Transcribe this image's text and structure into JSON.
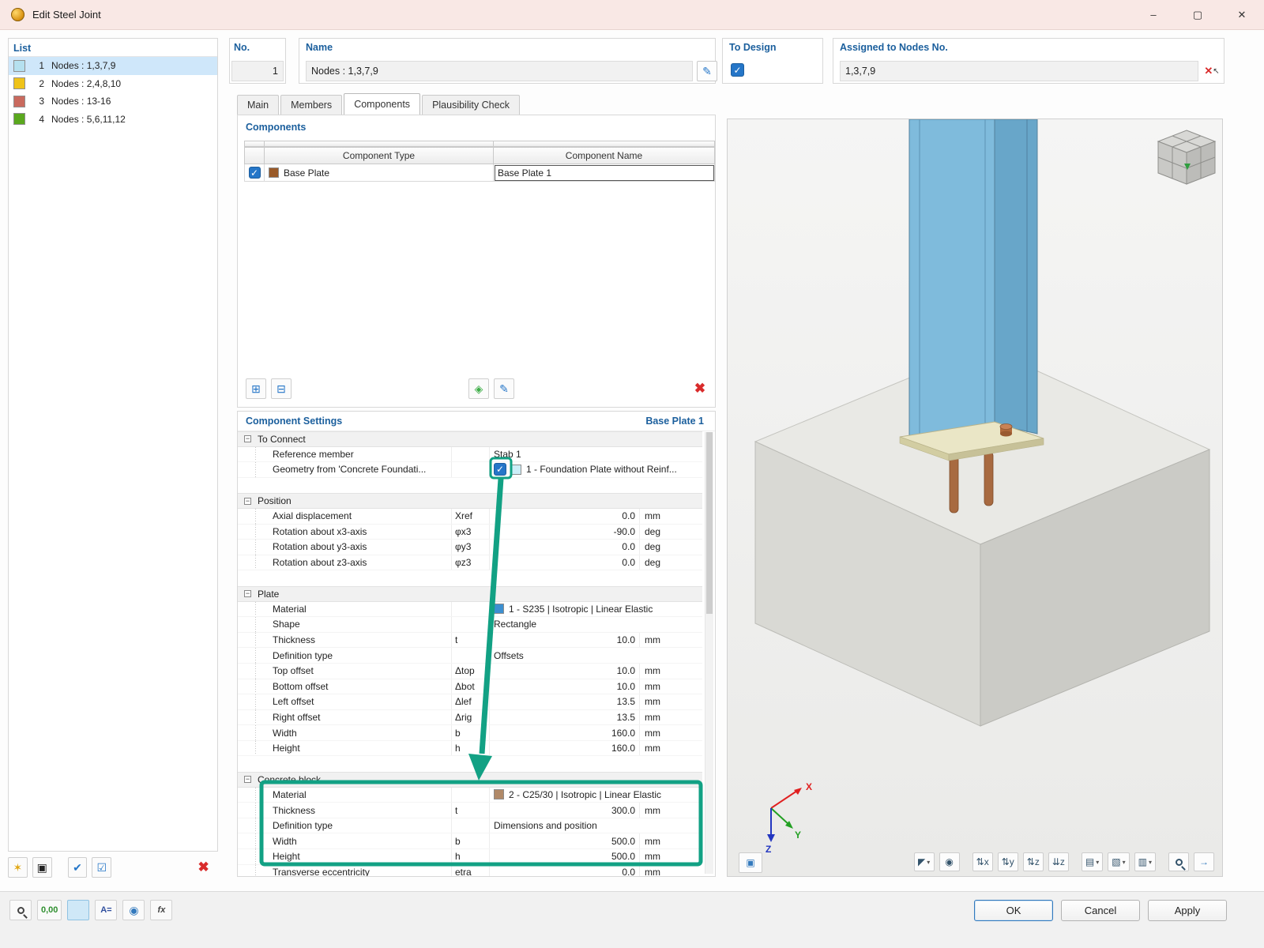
{
  "window": {
    "title": "Edit Steel Joint"
  },
  "icons": {
    "minimize": "–",
    "maximize": "▢",
    "close": "✕",
    "check": "✓",
    "collapse": "−",
    "caret": "▾",
    "edit_pencil": "✎",
    "pick_cross": "✕",
    "pick_cursor": "↖",
    "new_item": "✶",
    "copy_item": "▣",
    "check_all": "✔",
    "check_select": "☑",
    "delete_red": "✖",
    "insert_row": "⊞",
    "delete_row": "⊟",
    "import_lib": "◈",
    "save_template": "✎",
    "view_direction": "◤",
    "camera": "◉",
    "flip_x": "⇅x",
    "flip_y": "⇅y",
    "flip_z": "⇅z",
    "flip_z2": "⇊z",
    "layers": "▤",
    "display_style": "▧",
    "printer": "▥",
    "pan_arrow": "→",
    "navigator": "▣",
    "decimals": "0,00",
    "format_a": "A=",
    "display_eye": "◉",
    "formula": "fx"
  },
  "colors": {
    "accent_blue": "#1b5f9d",
    "annotation_green": "#12a184",
    "check_blue": "#2576c8",
    "delete_red": "#d92b2b"
  },
  "list": {
    "label": "List",
    "items": [
      {
        "no": "1",
        "name": "Nodes : 1,3,7,9",
        "color": "#b5e0ef",
        "selected": true
      },
      {
        "no": "2",
        "name": "Nodes : 2,4,8,10",
        "color": "#efc319",
        "selected": false
      },
      {
        "no": "3",
        "name": "Nodes : 13-16",
        "color": "#c96a5e",
        "selected": false
      },
      {
        "no": "4",
        "name": "Nodes : 5,6,11,12",
        "color": "#5aa81e",
        "selected": false
      }
    ]
  },
  "header": {
    "no_label": "No.",
    "no_value": "1",
    "name_label": "Name",
    "name_value": "Nodes : 1,3,7,9",
    "to_design_label": "To Design",
    "to_design_checked": true,
    "assigned_label": "Assigned to Nodes No.",
    "assigned_value": "1,3,7,9"
  },
  "tabs": {
    "main": "Main",
    "members": "Members",
    "components": "Components",
    "plausibility": "Plausibility Check"
  },
  "components": {
    "title": "Components",
    "col_type": "Component Type",
    "col_name": "Component Name",
    "row": {
      "checked": true,
      "type": "Base Plate",
      "name": "Base Plate 1",
      "type_color": "#9a5a28"
    }
  },
  "settings": {
    "title": "Component Settings",
    "target": "Base Plate 1",
    "groups": [
      {
        "label": "To Connect",
        "rows": [
          {
            "label": "Reference member",
            "sym": "",
            "value": "Stab 1",
            "unit": ""
          },
          {
            "label": "Geometry from 'Concrete Foundati...",
            "sym": "",
            "value": "1 - Foundation Plate without Reinf...",
            "unit": "",
            "checked": true,
            "swatch": "#cdeef8"
          }
        ]
      },
      {
        "label": "Position",
        "rows": [
          {
            "label": "Axial displacement",
            "sym": "Xref",
            "value": "0.0",
            "unit": "mm"
          },
          {
            "label": "Rotation about x3-axis",
            "sym": "φx3",
            "value": "-90.0",
            "unit": "deg"
          },
          {
            "label": "Rotation about y3-axis",
            "sym": "φy3",
            "value": "0.0",
            "unit": "deg"
          },
          {
            "label": "Rotation about z3-axis",
            "sym": "φz3",
            "value": "0.0",
            "unit": "deg"
          }
        ]
      },
      {
        "label": "Plate",
        "rows": [
          {
            "label": "Material",
            "sym": "",
            "value": "1 - S235 | Isotropic | Linear Elastic",
            "unit": "",
            "swatch": "#3c8fd0"
          },
          {
            "label": "Shape",
            "sym": "",
            "value": "Rectangle",
            "unit": ""
          },
          {
            "label": "Thickness",
            "sym": "t",
            "value": "10.0",
            "unit": "mm"
          },
          {
            "label": "Definition type",
            "sym": "",
            "value": "Offsets",
            "unit": ""
          },
          {
            "label": "Top offset",
            "sym": "Δtop",
            "value": "10.0",
            "unit": "mm"
          },
          {
            "label": "Bottom offset",
            "sym": "Δbot",
            "value": "10.0",
            "unit": "mm"
          },
          {
            "label": "Left offset",
            "sym": "Δlef",
            "value": "13.5",
            "unit": "mm"
          },
          {
            "label": "Right offset",
            "sym": "Δrig",
            "value": "13.5",
            "unit": "mm"
          },
          {
            "label": "Width",
            "sym": "b",
            "value": "160.0",
            "unit": "mm"
          },
          {
            "label": "Height",
            "sym": "h",
            "value": "160.0",
            "unit": "mm"
          }
        ]
      },
      {
        "label": "Concrete block",
        "rows": [
          {
            "label": "Material",
            "sym": "",
            "value": "2 - C25/30 | Isotropic | Linear Elastic",
            "unit": "",
            "swatch": "#b08968"
          },
          {
            "label": "Thickness",
            "sym": "t",
            "value": "300.0",
            "unit": "mm"
          },
          {
            "label": "Definition type",
            "sym": "",
            "value": "Dimensions and position",
            "unit": ""
          },
          {
            "label": "Width",
            "sym": "b",
            "value": "500.0",
            "unit": "mm"
          },
          {
            "label": "Height",
            "sym": "h",
            "value": "500.0",
            "unit": "mm"
          },
          {
            "label": "Transverse eccentricity",
            "sym": "etra",
            "value": "0.0",
            "unit": "mm"
          }
        ]
      }
    ]
  },
  "viewport": {
    "axis_x": "X",
    "axis_y": "Y",
    "axis_z": "Z"
  },
  "footer": {
    "ok": "OK",
    "cancel": "Cancel",
    "apply": "Apply"
  }
}
